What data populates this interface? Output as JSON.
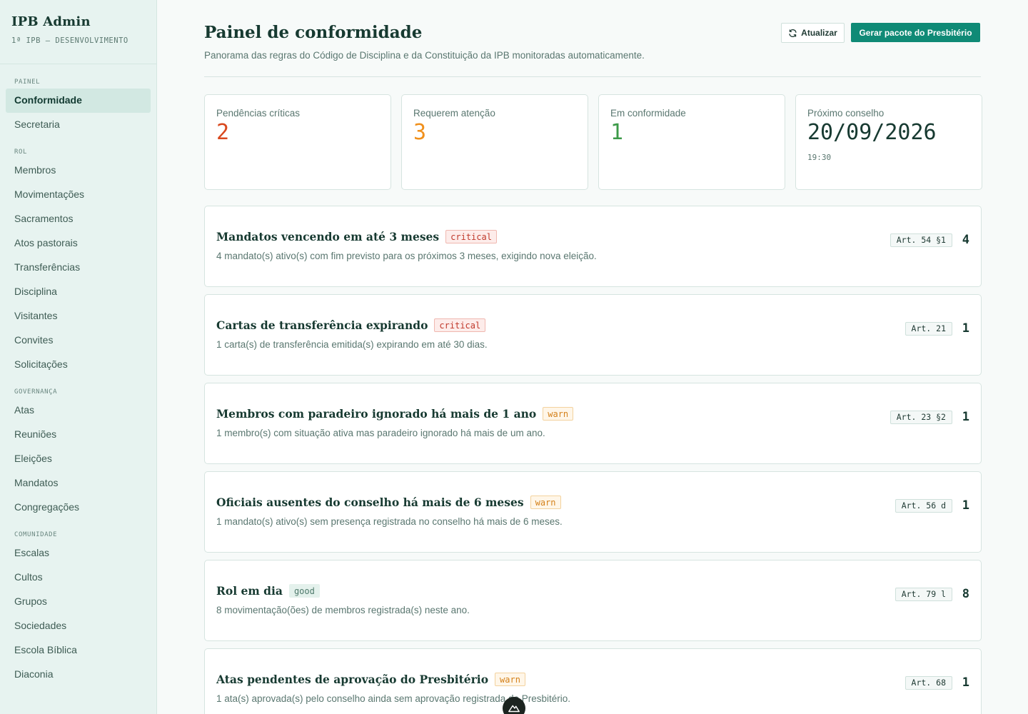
{
  "brand": {
    "title": "IPB Admin",
    "subtitle": "1ª IPB — DESENVOLVIMENTO"
  },
  "sidebar": {
    "sections": [
      {
        "title": "PAINEL",
        "items": [
          {
            "label": "Conformidade",
            "active": true
          },
          {
            "label": "Secretaria"
          }
        ]
      },
      {
        "title": "ROL",
        "items": [
          {
            "label": "Membros"
          },
          {
            "label": "Movimentações"
          },
          {
            "label": "Sacramentos"
          },
          {
            "label": "Atos pastorais"
          },
          {
            "label": "Transferências"
          },
          {
            "label": "Disciplina"
          },
          {
            "label": "Visitantes"
          },
          {
            "label": "Convites"
          },
          {
            "label": "Solicitações"
          }
        ]
      },
      {
        "title": "GOVERNANÇA",
        "items": [
          {
            "label": "Atas"
          },
          {
            "label": "Reuniões"
          },
          {
            "label": "Eleições"
          },
          {
            "label": "Mandatos"
          },
          {
            "label": "Congregações"
          }
        ]
      },
      {
        "title": "COMUNIDADE",
        "items": [
          {
            "label": "Escalas"
          },
          {
            "label": "Cultos"
          },
          {
            "label": "Grupos"
          },
          {
            "label": "Sociedades"
          },
          {
            "label": "Escola Bíblica"
          },
          {
            "label": "Diaconia"
          }
        ]
      }
    ]
  },
  "header": {
    "title": "Painel de conformidade",
    "description": "Panorama das regras do Código de Disciplina e da Constituição da IPB monitoradas automaticamente.",
    "refresh_label": "Atualizar",
    "primary_label": "Gerar pacote do Presbitério"
  },
  "stats": {
    "critical": {
      "label": "Pendências críticas",
      "value": "2",
      "color": "#d9491f"
    },
    "attention": {
      "label": "Requerem atenção",
      "value": "3",
      "color": "#f0901c"
    },
    "compliant": {
      "label": "Em conformidade",
      "value": "1",
      "color": "#3c9a48"
    },
    "next_council": {
      "label": "Próximo conselho",
      "date": "20/09/2026",
      "time": "19:30"
    }
  },
  "rules": [
    {
      "title": "Mandatos vencendo em até 3 meses",
      "severity": "critical",
      "description": "4 mandato(s) ativo(s) com fim previsto para os próximos 3 meses, exigindo nova eleição.",
      "article": "Art. 54 §1",
      "count": "4"
    },
    {
      "title": "Cartas de transferência expirando",
      "severity": "critical",
      "description": "1 carta(s) de transferência emitida(s) expirando em até 30 dias.",
      "article": "Art. 21",
      "count": "1"
    },
    {
      "title": "Membros com paradeiro ignorado há mais de 1 ano",
      "severity": "warn",
      "description": "1 membro(s) com situação ativa mas paradeiro ignorado há mais de um ano.",
      "article": "Art. 23 §2",
      "count": "1"
    },
    {
      "title": "Oficiais ausentes do conselho há mais de 6 meses",
      "severity": "warn",
      "description": "1 mandato(s) ativo(s) sem presença registrada no conselho há mais de 6 meses.",
      "article": "Art. 56 d",
      "count": "1"
    },
    {
      "title": "Rol em dia",
      "severity": "good",
      "description": "8 movimentação(ões) de membros registrada(s) neste ano.",
      "article": "Art. 79 l",
      "count": "8"
    },
    {
      "title": "Atas pendentes de aprovação do Presbitério",
      "severity": "warn",
      "description": "1 ata(s) aprovada(s) pelo conselho ainda sem aprovação registrada do Presbitério.",
      "article": "Art. 68",
      "count": "1"
    }
  ]
}
